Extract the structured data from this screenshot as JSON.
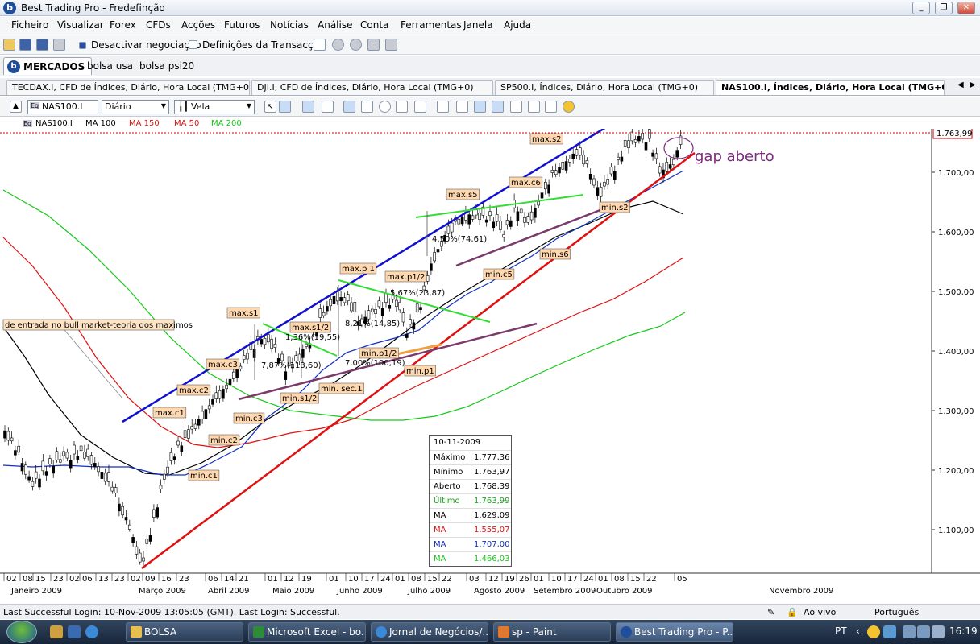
{
  "window": {
    "title": "Best Trading Pro - Fredefinção"
  },
  "menu": [
    "Ficheiro",
    "Visualizar",
    "Forex",
    "CFDs",
    "Acções",
    "Futuros",
    "Notícias",
    "Análise",
    "Conta",
    "Ferramentas",
    "Janela",
    "Ajuda"
  ],
  "toolbar": {
    "deactivate_label": "Desactivar negociação",
    "settings_label": "Definições da Transacção"
  },
  "main_tabs": [
    "MERCADOS",
    "bolsa usa",
    "bolsa psi20"
  ],
  "chart_tabs": [
    "TECDAX.I, CFD de Índices, Diário, Hora Local (TMG+0)",
    "DJI.I, CFD de Índices, Diário, Hora Local (TMG+0)",
    "SP500.I, Índices, Diário, Hora Local (TMG+0)",
    "NAS100.I, Índices, Diário, Hora Local (TMG+0)"
  ],
  "chart_toolbar": {
    "symbol": "NAS100.I",
    "period": "Diário",
    "chart_type": "Vela"
  },
  "legend": {
    "symbol": "NAS100.I",
    "ma1": "MA 100",
    "ma2": "MA 150",
    "ma3": "MA 50",
    "ma4": "MA 200"
  },
  "colors": {
    "ma100": "#000000",
    "ma150": "#e01010",
    "ma50": "#1030c0",
    "ma200": "#18c818",
    "channel": "#1010d0",
    "support": "#e01010",
    "purple": "#7a3a6a",
    "lime": "#33dd33",
    "orange": "#f0a040",
    "annotation": "#7a2a7a",
    "price_line": "#cc0000"
  },
  "annotations": {
    "gap": "gap aberto",
    "note": "de entrada no bull market-teoria dos maximos"
  },
  "labels": [
    "max.s2",
    "max.s5",
    "max.c6",
    "min.s2",
    "min.s6",
    "min.c5",
    "max.p 1",
    "max.p1/2",
    "min.p1/2",
    "min.p1",
    "max.s1",
    "max.s1/2",
    "max.c3",
    "max.c2",
    "max.c1",
    "min.c3",
    "min.c2",
    "min.c1",
    "min.s1/2",
    "min. sec.1"
  ],
  "measures": [
    "4,50%(74,61)",
    "5,67%(23,87)",
    "8,21%(14,85)",
    "1,36%(19,55)",
    "7,87%(113,60)",
    "7,00%(100,19)"
  ],
  "price_axis": [
    "1.700,00",
    "1.600,00",
    "1.500,00",
    "1.400,00",
    "1.300,00",
    "1.200,00",
    "1.100,00"
  ],
  "current_price": "1.763,99",
  "x_days": [
    "02",
    "08",
    "15",
    "23",
    "02",
    "06",
    "13",
    "23",
    "02",
    "09",
    "16",
    "23",
    "06",
    "14",
    "21",
    "01",
    "12",
    "19",
    "01",
    "10",
    "17",
    "24",
    "01",
    "08",
    "15",
    "22",
    "03",
    "12",
    "19",
    "26",
    "01",
    "10",
    "17",
    "24",
    "01",
    "08",
    "15",
    "22",
    "05"
  ],
  "x_months": [
    "Janeiro 2009",
    "Março 2009",
    "Abril 2009",
    "Maio 2009",
    "Junho 2009",
    "Julho 2009",
    "Agosto 2009",
    "Setembro 2009",
    "Outubro 2009",
    "Novembro 2009"
  ],
  "info": {
    "date": "10-11-2009",
    "rows": [
      {
        "k": "Máximo",
        "v": "1.777,36",
        "c": "#000"
      },
      {
        "k": "Mínimo",
        "v": "1.763,97",
        "c": "#000"
      },
      {
        "k": "Aberto",
        "v": "1.768,39",
        "c": "#000"
      },
      {
        "k": "Último",
        "v": "1.763,99",
        "c": "#18a018"
      },
      {
        "k": "MA",
        "v": "1.629,09",
        "c": "#000"
      },
      {
        "k": "MA",
        "v": "1.555,07",
        "c": "#e01010"
      },
      {
        "k": "MA",
        "v": "1.707,00",
        "c": "#1030c0"
      },
      {
        "k": "MA",
        "v": "1.466,03",
        "c": "#18c818"
      }
    ]
  },
  "status": {
    "login": "Last Successful Login: 10-Nov-2009 13:05:05 (GMT). Last Login: Successful.",
    "live": "Ao vivo",
    "lang": "Português"
  },
  "taskbar": {
    "items": [
      "BOLSA",
      "Microsoft Excel - bo...",
      "Jornal de Negócios/...",
      "sp - Paint",
      "Best Trading Pro - P..."
    ],
    "lang": "PT",
    "time": "16:19"
  }
}
